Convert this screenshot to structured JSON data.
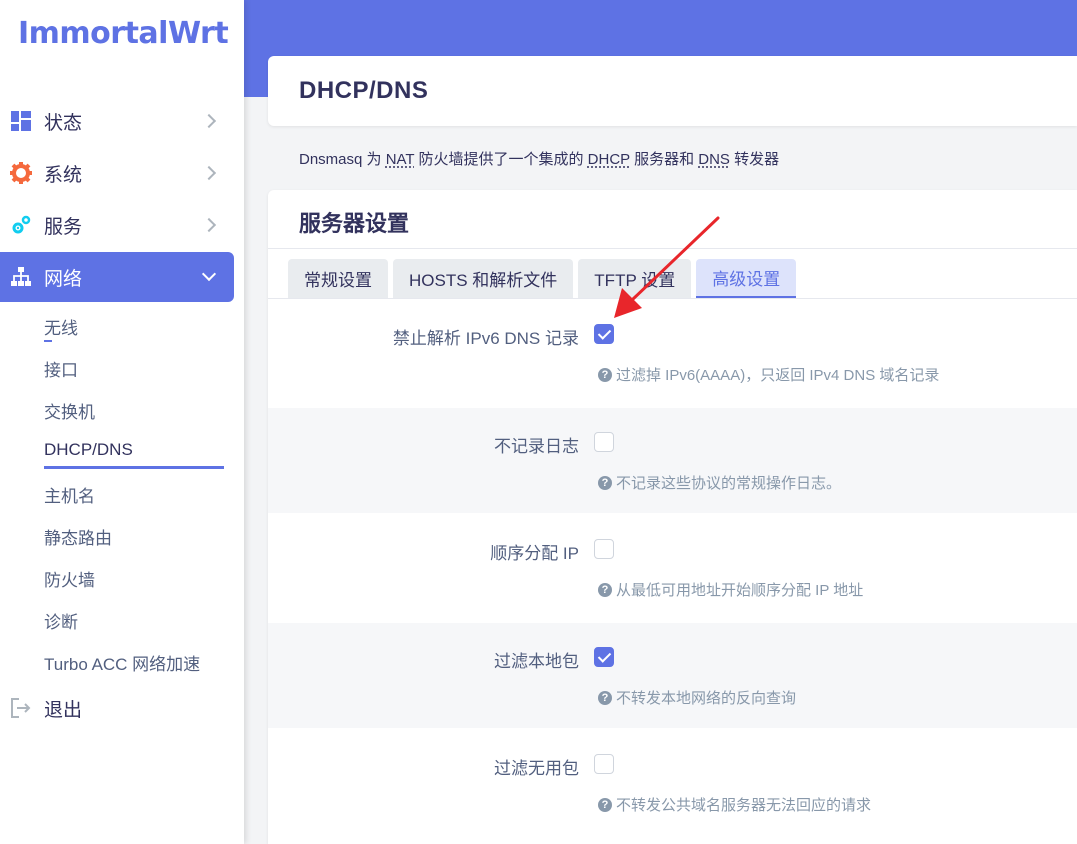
{
  "brand": "ImmortalWrt",
  "menu": [
    {
      "label": "状态",
      "icon": "dashboard-icon"
    },
    {
      "label": "系统",
      "icon": "gear-icon"
    },
    {
      "label": "服务",
      "icon": "cogs-icon"
    },
    {
      "label": "网络",
      "icon": "network-icon"
    },
    {
      "label": "退出",
      "icon": "logout-icon"
    }
  ],
  "submenu": [
    "无线",
    "接口",
    "交换机",
    "DHCP/DNS",
    "主机名",
    "静态路由",
    "防火墙",
    "诊断",
    "Turbo ACC 网络加速"
  ],
  "page_title": "DHCP/DNS",
  "description": {
    "p1": "Dnsmasq 为 ",
    "nat": "NAT",
    "p2": " 防火墙提供了一个集成的 ",
    "dhcp": "DHCP",
    "p3": " 服务器和 ",
    "dns": "DNS",
    "p4": " 转发器"
  },
  "section_title": "服务器设置",
  "tabs": [
    "常规设置",
    "HOSTS 和解析文件",
    "TFTP 设置",
    "高级设置"
  ],
  "active_tab": "高级设置",
  "options": [
    {
      "label": "禁止解析 IPv6 DNS 记录",
      "checked": true,
      "hint": "过滤掉 IPv6(AAAA)，只返回 IPv4 DNS 域名记录"
    },
    {
      "label": "不记录日志",
      "checked": false,
      "hint": "不记录这些协议的常规操作日志。"
    },
    {
      "label": "顺序分配 IP",
      "checked": false,
      "hint": "从最低可用地址开始顺序分配 IP 地址"
    },
    {
      "label": "过滤本地包",
      "checked": true,
      "hint": "不转发本地网络的反向查询"
    },
    {
      "label": "过滤无用包",
      "checked": false,
      "hint": "不转发公共域名服务器无法回应的请求"
    }
  ],
  "colors": {
    "accent": "#5e72e4",
    "arrow": "#e8262b"
  }
}
